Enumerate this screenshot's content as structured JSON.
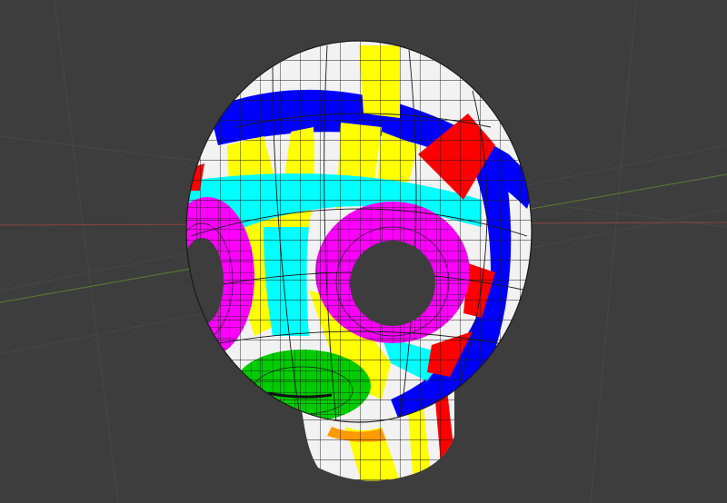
{
  "viewport": {
    "background": "#3d3d3d",
    "grid_color": "#4a4a4a",
    "x_axis_color": "#a54b4b",
    "y_axis_color": "#6b8a3a"
  },
  "model": {
    "object": "head-mesh",
    "wire_color": "#1a1a1a",
    "face_colors": {
      "white": "#f2f2f2",
      "yellow": "#ffff00",
      "cyan": "#00ffff",
      "magenta": "#ff00ff",
      "blue": "#0000ff",
      "red": "#ff0000",
      "green": "#00cc00"
    }
  }
}
